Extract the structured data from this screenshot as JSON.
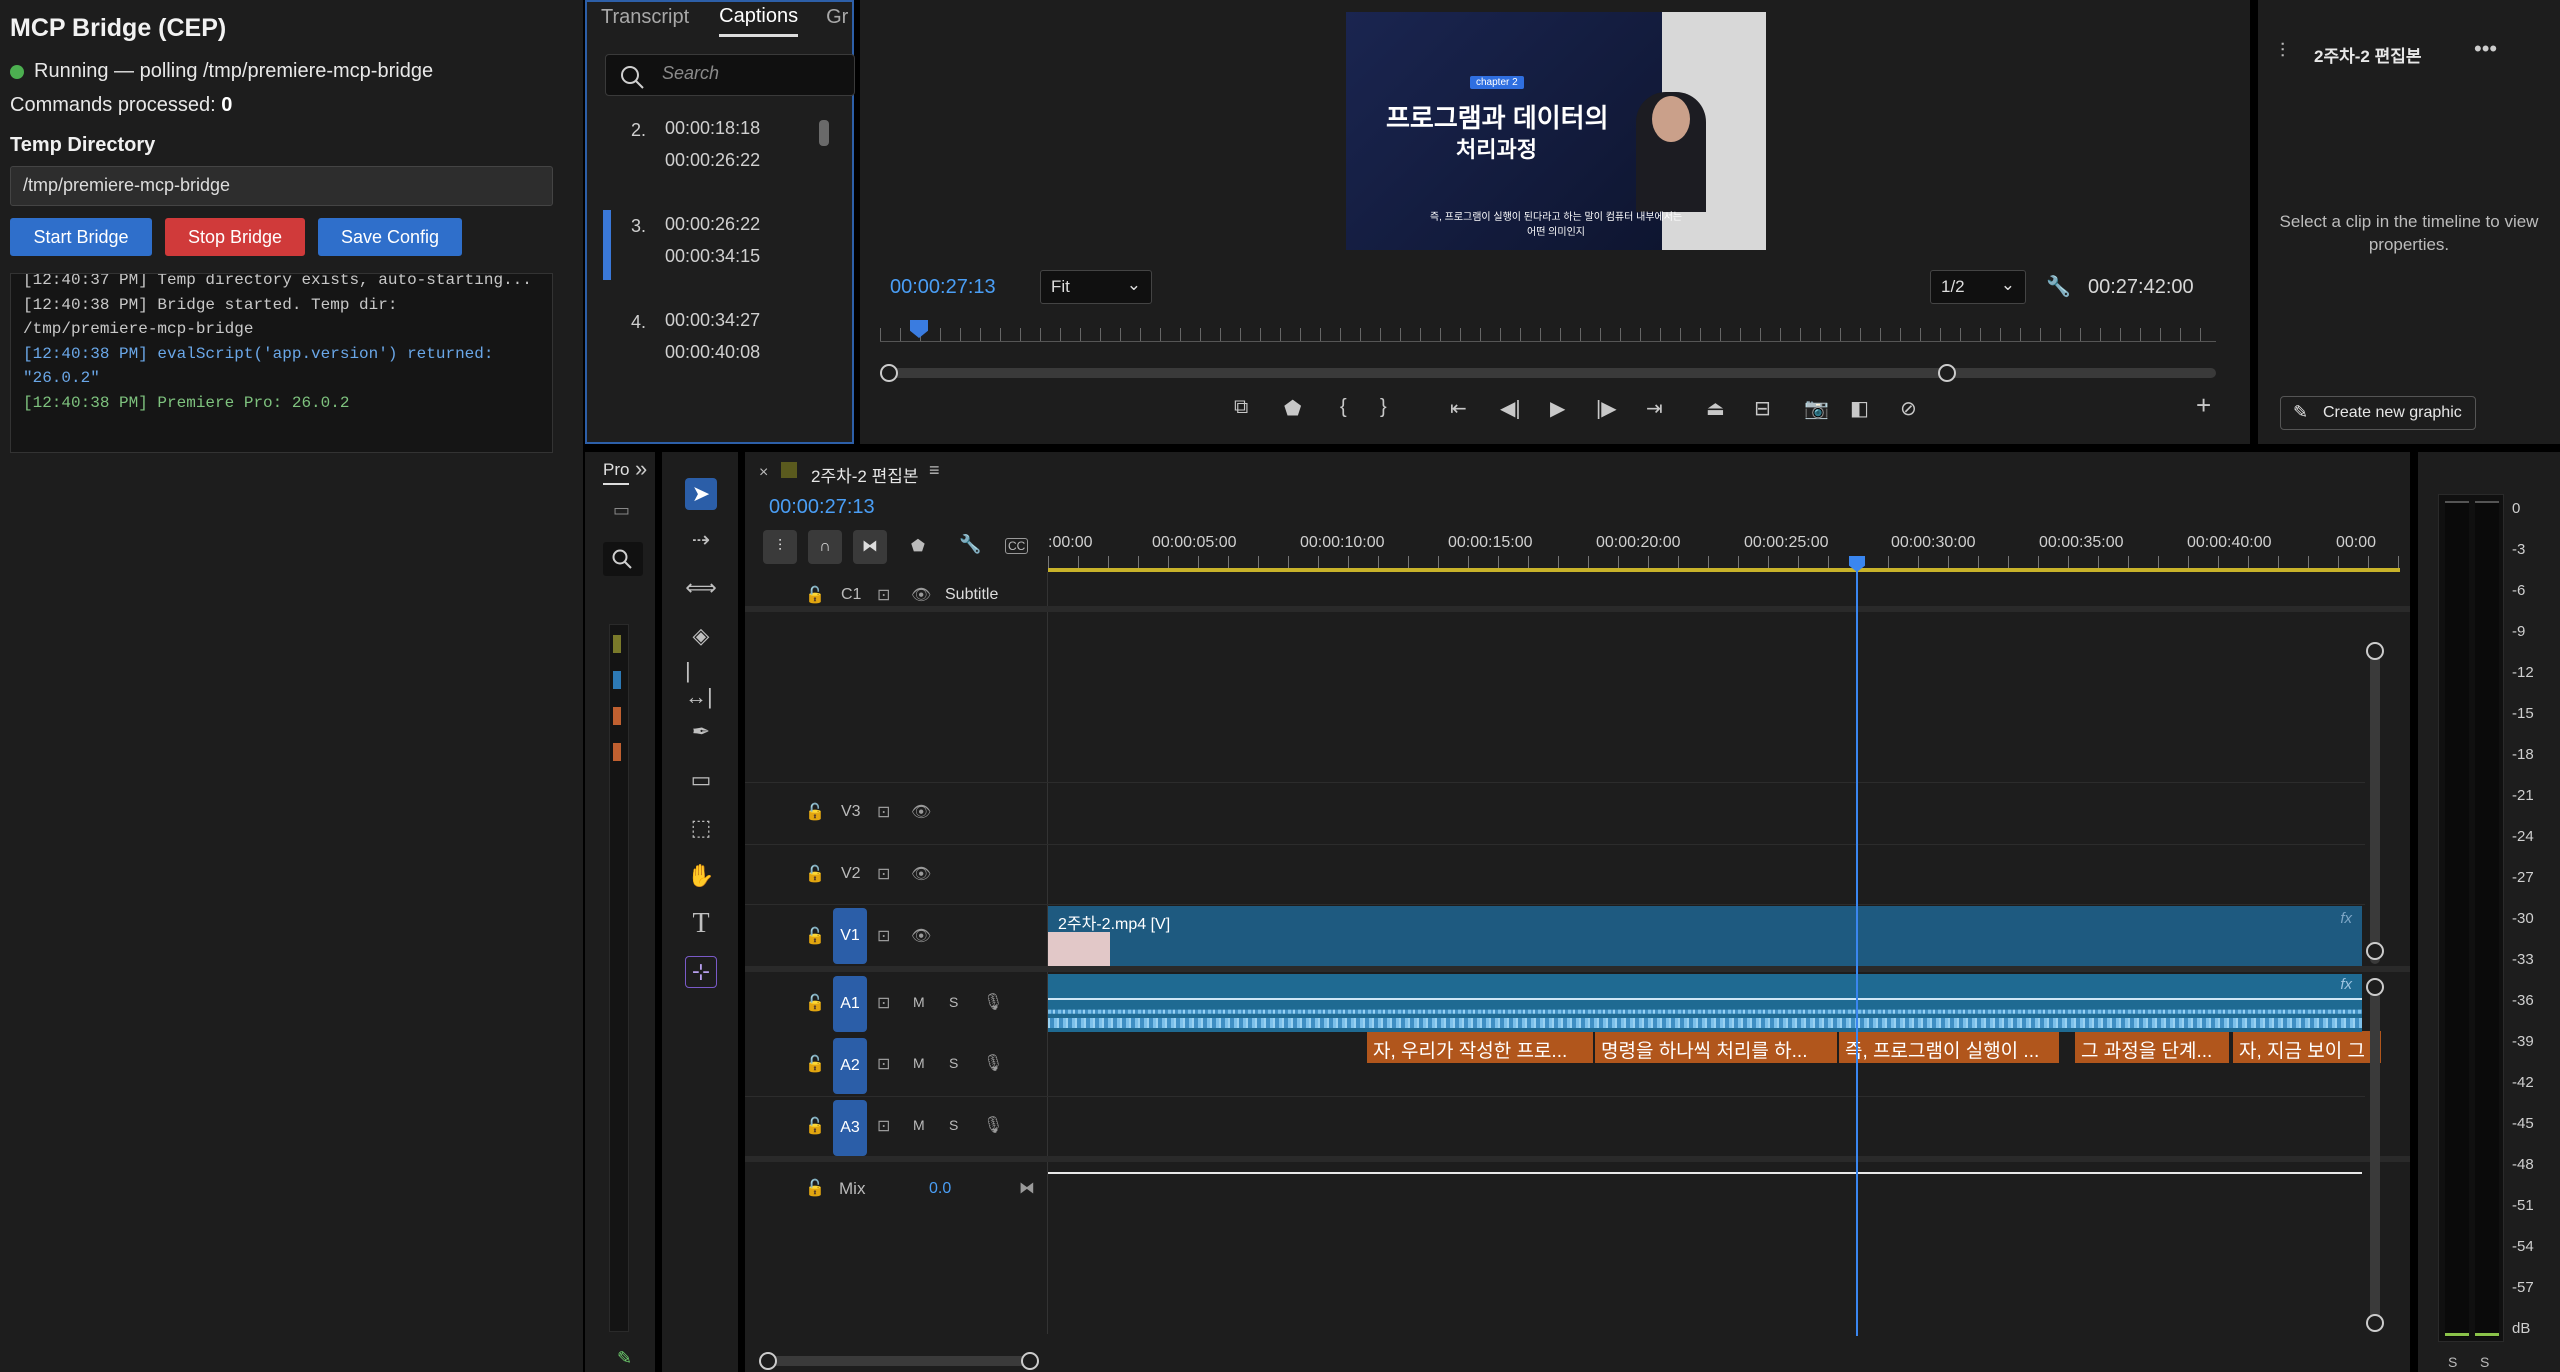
{
  "mcp": {
    "title": "MCP Bridge (CEP)",
    "status": "Running — polling /tmp/premiere-mcp-bridge",
    "commands_label": "Commands processed:",
    "commands_count": "0",
    "temp_dir_label": "Temp Directory",
    "temp_dir_value": "/tmp/premiere-mcp-bridge",
    "start_label": "Start Bridge",
    "stop_label": "Stop Bridge",
    "save_label": "Save Config",
    "log": [
      "[12:40:37 PM] Temp directory exists, auto-starting...",
      "[12:40:38 PM] Bridge started. Temp dir: /tmp/premiere-mcp-bridge",
      "[12:40:38 PM] evalScript('app.version') returned: \"26.0.2\"",
      "[12:40:38 PM] Premiere Pro: 26.0.2"
    ],
    "colors": {
      "start": "#2f6fcb",
      "stop": "#d03a3a",
      "save": "#2f6fcb",
      "log_info": "#6aa7e8",
      "log_success": "#7ec27e"
    }
  },
  "captions": {
    "tabs": [
      "Transcript",
      "Captions",
      "Gr"
    ],
    "search_placeholder": "Search",
    "items": [
      {
        "n": "2.",
        "in": "00:00:18:18",
        "out": "00:00:26:22"
      },
      {
        "n": "3.",
        "in": "00:00:26:22",
        "out": "00:00:34:15"
      },
      {
        "n": "4.",
        "in": "00:00:34:27",
        "out": "00:00:40:08"
      }
    ]
  },
  "program": {
    "current_time": "00:00:27:13",
    "fit": "Fit",
    "resolution": "1/2",
    "duration": "00:27:42:00",
    "video_chapter": "chapter 2",
    "video_title_line1": "프로그램과 데이터의",
    "video_title_line2": "처리과정",
    "video_subtitle_line1": "즉, 프로그램이 실행이 된다라고 하는 말이 컴퓨터 내부에서는",
    "video_subtitle_line2": "어떤 의미인지"
  },
  "properties": {
    "title": "2주차-2 편집본",
    "empty_message": "Select a clip in the timeline to view properties.",
    "create_graphic": "Create new graphic"
  },
  "project": {
    "tab": "Pro"
  },
  "timeline": {
    "sequence_name": "2주차-2 편집본",
    "timecode": "00:00:27:13",
    "ruler": [
      ":00:00",
      "00:00:05:00",
      "00:00:10:00",
      "00:00:15:00",
      "00:00:20:00",
      "00:00:25:00",
      "00:00:30:00",
      "00:00:35:00",
      "00:00:40:00",
      "00:00"
    ],
    "tracks": {
      "c1": {
        "label": "C1",
        "name": "Subtitle"
      },
      "v3": "V3",
      "v2": "V2",
      "v1": "V1",
      "a1": "A1",
      "a2": "A2",
      "a3": "A3",
      "mix": "Mix",
      "mix_value": "0.0",
      "m": "M",
      "s": "S"
    },
    "video_clip": "2주차-2.mp4 [V]",
    "caption_clips": [
      "자, 우리가 작성한 프로...",
      "명령을 하나씩 처리를 하...",
      "즉, 프로그램이 실행이 ...",
      "그 과정을 단계...",
      "자, 지금 보이 그"
    ]
  },
  "meter": {
    "scale": [
      "0",
      "-3",
      "-6",
      "-9",
      "-12",
      "-15",
      "-18",
      "-21",
      "-24",
      "-27",
      "-30",
      "-33",
      "-36",
      "-39",
      "-42",
      "-45",
      "-48",
      "-51",
      "-54",
      "-57",
      "dB"
    ],
    "solo": [
      "S",
      "S"
    ]
  }
}
